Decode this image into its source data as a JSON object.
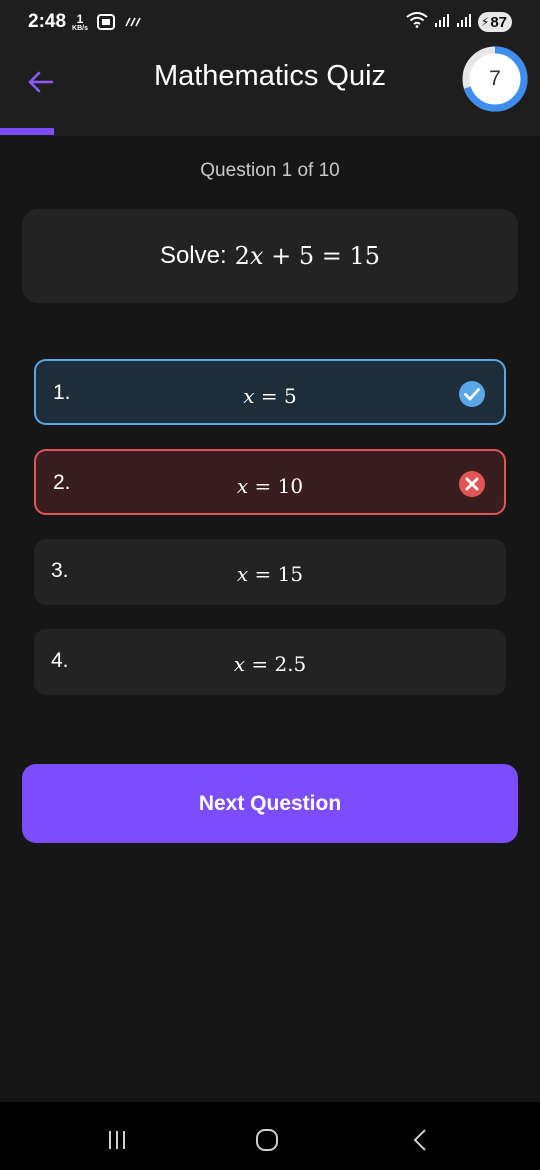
{
  "status_bar": {
    "time": "2:48",
    "net_speed_value": "1",
    "net_speed_unit": "KB/s",
    "battery": "87"
  },
  "app_bar": {
    "title": "Mathematics Quiz",
    "timer_value": "7",
    "timer_fraction": 0.7
  },
  "progress": {
    "fraction": 0.1
  },
  "question": {
    "counter": "Question 1 of 10",
    "prefix": "Solve:",
    "expression": "2x + 5 = 15"
  },
  "options": [
    {
      "number": "1.",
      "value": "x = 5",
      "state": "correct"
    },
    {
      "number": "2.",
      "value": "x = 10",
      "state": "wrong"
    },
    {
      "number": "3.",
      "value": "x = 15",
      "state": "neutral"
    },
    {
      "number": "4.",
      "value": "x = 2.5",
      "state": "neutral"
    }
  ],
  "next_button": {
    "label": "Next Question"
  },
  "colors": {
    "accent": "#7c4dff",
    "correct": "#5aa6e6",
    "wrong": "#e05555",
    "background": "#161616",
    "card": "#232323"
  },
  "icons": {
    "back": "arrow-left-icon",
    "correct": "check-circle-icon",
    "wrong": "x-circle-icon",
    "nav_recents": "recents-icon",
    "nav_home": "home-icon",
    "nav_back": "chevron-left-icon"
  }
}
